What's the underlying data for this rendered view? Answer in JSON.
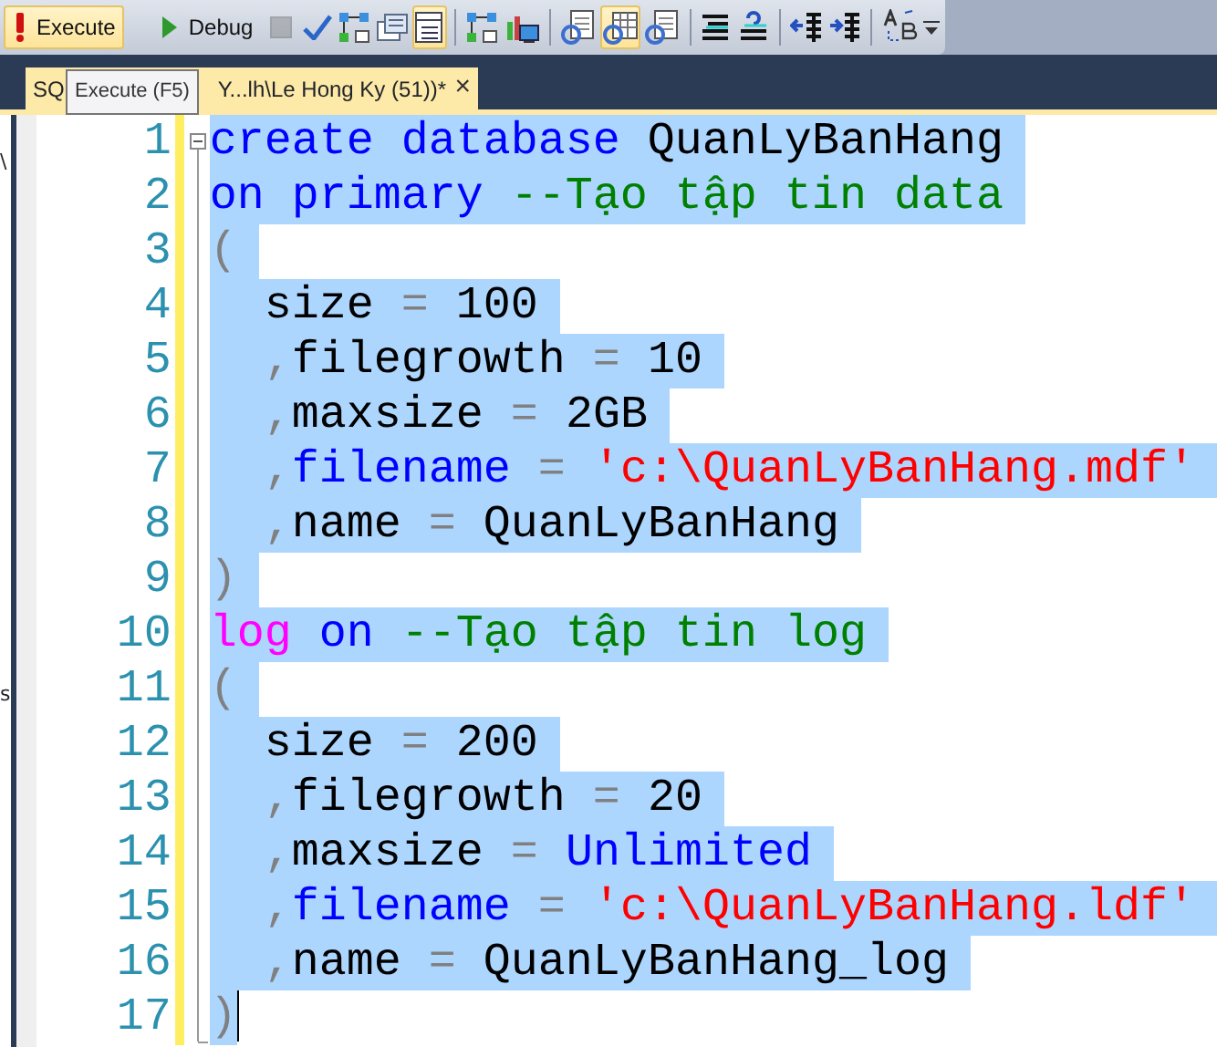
{
  "toolbar": {
    "buttons": [
      {
        "kind": "execute",
        "label": "Execute",
        "hover": true
      },
      {
        "kind": "debug",
        "label": "Debug",
        "hover": false
      }
    ],
    "icons": [
      {
        "kind": "stop",
        "on": false,
        "disabled": true
      },
      {
        "kind": "check",
        "on": false,
        "disabled": false
      },
      {
        "kind": "flow",
        "on": false,
        "disabled": false
      },
      {
        "kind": "windows",
        "on": false,
        "disabled": false
      },
      {
        "kind": "list",
        "on": true,
        "disabled": false
      },
      {
        "kind": "sep"
      },
      {
        "kind": "flow",
        "on": false,
        "disabled": false
      },
      {
        "kind": "server",
        "on": false,
        "disabled": false
      },
      {
        "kind": "sep"
      },
      {
        "kind": "docrefresh",
        "on": false,
        "disabled": false
      },
      {
        "kind": "gridrefresh",
        "on": true,
        "disabled": false
      },
      {
        "kind": "docrefresh",
        "on": false,
        "disabled": false
      },
      {
        "kind": "sep"
      },
      {
        "kind": "comment",
        "on": false,
        "disabled": false
      },
      {
        "kind": "uncomment",
        "on": false,
        "disabled": false
      },
      {
        "kind": "sep"
      },
      {
        "kind": "outdent",
        "on": false,
        "disabled": false
      },
      {
        "kind": "indent",
        "on": false,
        "disabled": false
      },
      {
        "kind": "sep"
      },
      {
        "kind": "replace",
        "on": false,
        "disabled": false
      },
      {
        "kind": "overflow",
        "on": false,
        "disabled": false
      }
    ]
  },
  "tooltip": "Execute (F5)",
  "tab": {
    "label_start": "SQ",
    "label_end": "Y...lh\\Le Hong Ky (51))*",
    "close": "×",
    "selected": true
  },
  "side_panel": [
    "\\",
    "s"
  ],
  "editor": {
    "lines": [
      {
        "number": "1",
        "selected": true,
        "cursor": false,
        "tokens": [
          {
            "kind": "keyword",
            "text": "create database"
          },
          {
            "kind": "plain",
            "text": " QuanLyBanHang"
          }
        ]
      },
      {
        "number": "2",
        "selected": true,
        "cursor": false,
        "tokens": [
          {
            "kind": "keyword",
            "text": "on primary"
          },
          {
            "kind": "comment",
            "text": " --Tạo tập tin data"
          }
        ]
      },
      {
        "number": "3",
        "selected": true,
        "cursor": false,
        "tokens": [
          {
            "kind": "operator",
            "text": "("
          }
        ]
      },
      {
        "number": "4",
        "selected": true,
        "cursor": false,
        "tokens": [
          {
            "kind": "plain",
            "text": "  size "
          },
          {
            "kind": "operator",
            "text": "="
          },
          {
            "kind": "plain",
            "text": " 100"
          }
        ]
      },
      {
        "number": "5",
        "selected": true,
        "cursor": false,
        "tokens": [
          {
            "kind": "operator",
            "text": "  ,"
          },
          {
            "kind": "plain",
            "text": "filegrowth "
          },
          {
            "kind": "operator",
            "text": "="
          },
          {
            "kind": "plain",
            "text": " 10"
          }
        ]
      },
      {
        "number": "6",
        "selected": true,
        "cursor": false,
        "tokens": [
          {
            "kind": "operator",
            "text": "  ,"
          },
          {
            "kind": "plain",
            "text": "maxsize "
          },
          {
            "kind": "operator",
            "text": "="
          },
          {
            "kind": "plain",
            "text": " 2GB"
          }
        ]
      },
      {
        "number": "7",
        "selected": true,
        "cursor": false,
        "tokens": [
          {
            "kind": "operator",
            "text": "  ,"
          },
          {
            "kind": "keyword",
            "text": "filename"
          },
          {
            "kind": "operator",
            "text": " = "
          },
          {
            "kind": "string",
            "text": "'c:\\QuanLyBanHang.mdf'"
          }
        ]
      },
      {
        "number": "8",
        "selected": true,
        "cursor": false,
        "tokens": [
          {
            "kind": "operator",
            "text": "  ,"
          },
          {
            "kind": "plain",
            "text": "name "
          },
          {
            "kind": "operator",
            "text": "="
          },
          {
            "kind": "plain",
            "text": " QuanLyBanHang"
          }
        ]
      },
      {
        "number": "9",
        "selected": true,
        "cursor": false,
        "tokens": [
          {
            "kind": "operator",
            "text": ")"
          }
        ]
      },
      {
        "number": "10",
        "selected": true,
        "cursor": false,
        "tokens": [
          {
            "kind": "function",
            "text": "log"
          },
          {
            "kind": "keyword",
            "text": " on"
          },
          {
            "kind": "comment",
            "text": " --Tạo tập tin log"
          }
        ]
      },
      {
        "number": "11",
        "selected": true,
        "cursor": false,
        "tokens": [
          {
            "kind": "operator",
            "text": "("
          }
        ]
      },
      {
        "number": "12",
        "selected": true,
        "cursor": false,
        "tokens": [
          {
            "kind": "plain",
            "text": "  size "
          },
          {
            "kind": "operator",
            "text": "="
          },
          {
            "kind": "plain",
            "text": " 200"
          }
        ]
      },
      {
        "number": "13",
        "selected": true,
        "cursor": false,
        "tokens": [
          {
            "kind": "operator",
            "text": "  ,"
          },
          {
            "kind": "plain",
            "text": "filegrowth "
          },
          {
            "kind": "operator",
            "text": "="
          },
          {
            "kind": "plain",
            "text": " 20"
          }
        ]
      },
      {
        "number": "14",
        "selected": true,
        "cursor": false,
        "tokens": [
          {
            "kind": "operator",
            "text": "  ,"
          },
          {
            "kind": "plain",
            "text": "maxsize "
          },
          {
            "kind": "operator",
            "text": "="
          },
          {
            "kind": "keyword",
            "text": " Unlimited"
          }
        ]
      },
      {
        "number": "15",
        "selected": true,
        "cursor": false,
        "tokens": [
          {
            "kind": "operator",
            "text": "  ,"
          },
          {
            "kind": "keyword",
            "text": "filename"
          },
          {
            "kind": "operator",
            "text": " = "
          },
          {
            "kind": "string",
            "text": "'c:\\QuanLyBanHang.ldf'"
          }
        ]
      },
      {
        "number": "16",
        "selected": true,
        "cursor": false,
        "tokens": [
          {
            "kind": "operator",
            "text": "  ,"
          },
          {
            "kind": "plain",
            "text": "name "
          },
          {
            "kind": "operator",
            "text": "="
          },
          {
            "kind": "plain",
            "text": " QuanLyBanHang_log"
          }
        ]
      },
      {
        "number": "17",
        "selected": true,
        "cursor": true,
        "tokens": [
          {
            "kind": "operator",
            "text": ")"
          }
        ]
      }
    ]
  }
}
